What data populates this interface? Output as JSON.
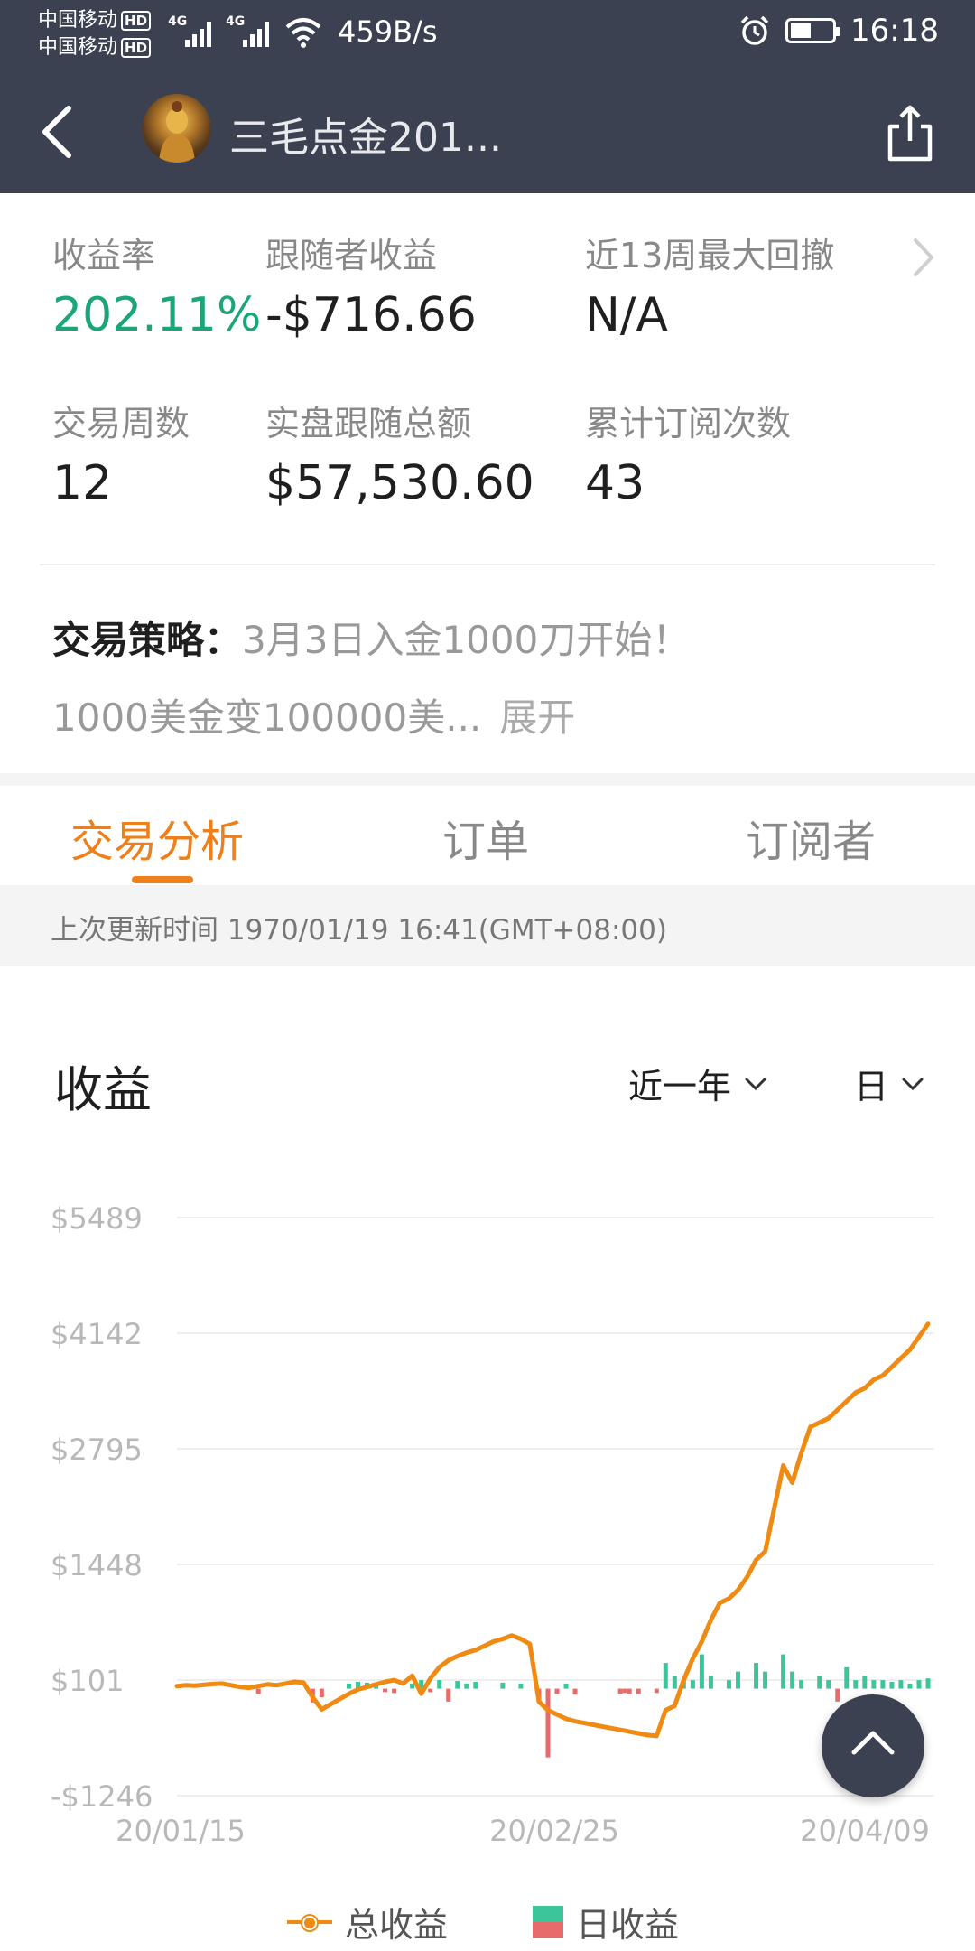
{
  "status_bar": {
    "carrier_1": "中国移动",
    "carrier_2": "中国移动",
    "hd_badge": "HD",
    "network_type": "4G",
    "speed": "459B/s",
    "time": "16:18"
  },
  "header": {
    "title": "三毛点金201..."
  },
  "stats": {
    "return_rate": {
      "label": "收益率",
      "value": "202.11%"
    },
    "follower_profit": {
      "label": "跟随者收益",
      "value": "-$716.66"
    },
    "max_drawdown": {
      "label": "近13周最大回撤",
      "value": "N/A"
    },
    "trading_weeks": {
      "label": "交易周数",
      "value": "12"
    },
    "follow_total": {
      "label": "实盘跟随总额",
      "value": "$57,530.60"
    },
    "subscriptions": {
      "label": "累计订阅次数",
      "value": "43"
    }
  },
  "strategy": {
    "label": "交易策略：",
    "text_line1": "3月3日入金1000刀开始！",
    "text_line2": "1000美金变100000美...",
    "expand": "展开"
  },
  "tabs": [
    {
      "label": "交易分析",
      "active": true
    },
    {
      "label": "订单",
      "active": false
    },
    {
      "label": "订阅者",
      "active": false
    }
  ],
  "update_text": "上次更新时间 1970/01/19 16:41(GMT+08:00)",
  "chart_section": {
    "title": "收益",
    "range_dropdown": "近一年",
    "period_dropdown": "日"
  },
  "colors": {
    "header_bg": "#3b4150",
    "accent_orange": "#ef7f1a",
    "positive_green": "#1aa57a",
    "bar_green": "#3cc59a",
    "bar_red": "#e86b6b",
    "line_orange": "#ef8a12"
  },
  "chart_data": {
    "type": "line",
    "title": "",
    "xlabel": "",
    "ylabel": "",
    "ylim": [
      -1246,
      5489
    ],
    "y_ticks": [
      "$5489",
      "$4142",
      "$2795",
      "$1448",
      "$101",
      "-$1246"
    ],
    "x_ticks": [
      "20/01/15",
      "20/02/25",
      "20/04/09"
    ],
    "grid": true,
    "legend_position": "bottom",
    "series": [
      {
        "name": "总收益",
        "kind": "line",
        "color": "#ef8a12",
        "x": [
          0,
          1,
          2,
          3,
          4,
          5,
          6,
          7,
          8,
          9,
          10,
          11,
          12,
          13,
          14,
          15,
          16,
          17,
          18,
          19,
          20,
          21,
          22,
          23,
          24,
          25,
          26,
          27,
          28,
          29,
          30,
          31,
          32,
          33,
          34,
          35,
          36,
          37,
          38,
          39,
          40,
          41,
          42,
          43,
          44,
          45,
          46,
          47,
          48,
          49,
          50,
          51,
          52,
          53,
          54,
          55,
          56,
          57,
          58,
          59,
          60,
          61,
          62,
          63,
          64,
          65,
          66,
          67,
          68,
          69,
          70,
          71,
          72,
          73,
          74,
          75,
          76,
          77,
          78,
          79,
          80,
          81,
          82,
          83
        ],
        "y": [
          30,
          40,
          35,
          45,
          55,
          60,
          40,
          20,
          10,
          30,
          50,
          40,
          60,
          80,
          70,
          -100,
          -240,
          -180,
          -120,
          -60,
          -10,
          20,
          50,
          80,
          100,
          60,
          150,
          -60,
          120,
          250,
          330,
          380,
          420,
          450,
          500,
          550,
          580,
          620,
          580,
          520,
          -150,
          -250,
          -300,
          -350,
          -380,
          -400,
          -420,
          -440,
          -460,
          -480,
          -500,
          -520,
          -540,
          -550,
          -250,
          -200,
          100,
          350,
          550,
          800,
          1000,
          1050,
          1150,
          1300,
          1500,
          1600,
          2100,
          2600,
          2400,
          2750,
          3050,
          3100,
          3150,
          3250,
          3350,
          3450,
          3500,
          3600,
          3650,
          3750,
          3850,
          3950,
          4100,
          4250
        ]
      },
      {
        "name": "日收益",
        "kind": "bar",
        "colors": {
          "positive": "#3cc59a",
          "negative": "#e86b6b"
        },
        "x": [
          9,
          15,
          16,
          19,
          20,
          21,
          22,
          23,
          24,
          26,
          27,
          28,
          29,
          30,
          31,
          32,
          33,
          36,
          38,
          40,
          41,
          42,
          43,
          44,
          49,
          49.5,
          50,
          51,
          53,
          54,
          55,
          56,
          57,
          58,
          59,
          61,
          62,
          64,
          65,
          67,
          68,
          69,
          71,
          72,
          73,
          74,
          75,
          76,
          77,
          78,
          79,
          80,
          81,
          82,
          83
        ],
        "y": [
          -60,
          -160,
          -100,
          60,
          80,
          70,
          60,
          -40,
          -50,
          60,
          100,
          -40,
          100,
          -150,
          90,
          60,
          80,
          70,
          60,
          -150,
          -800,
          -60,
          60,
          -70,
          -60,
          -50,
          -60,
          -60,
          -50,
          300,
          150,
          100,
          100,
          400,
          150,
          100,
          200,
          300,
          200,
          400,
          200,
          100,
          150,
          100,
          -150,
          250,
          100,
          150,
          100,
          100,
          80,
          100,
          60,
          100,
          120
        ]
      }
    ]
  }
}
